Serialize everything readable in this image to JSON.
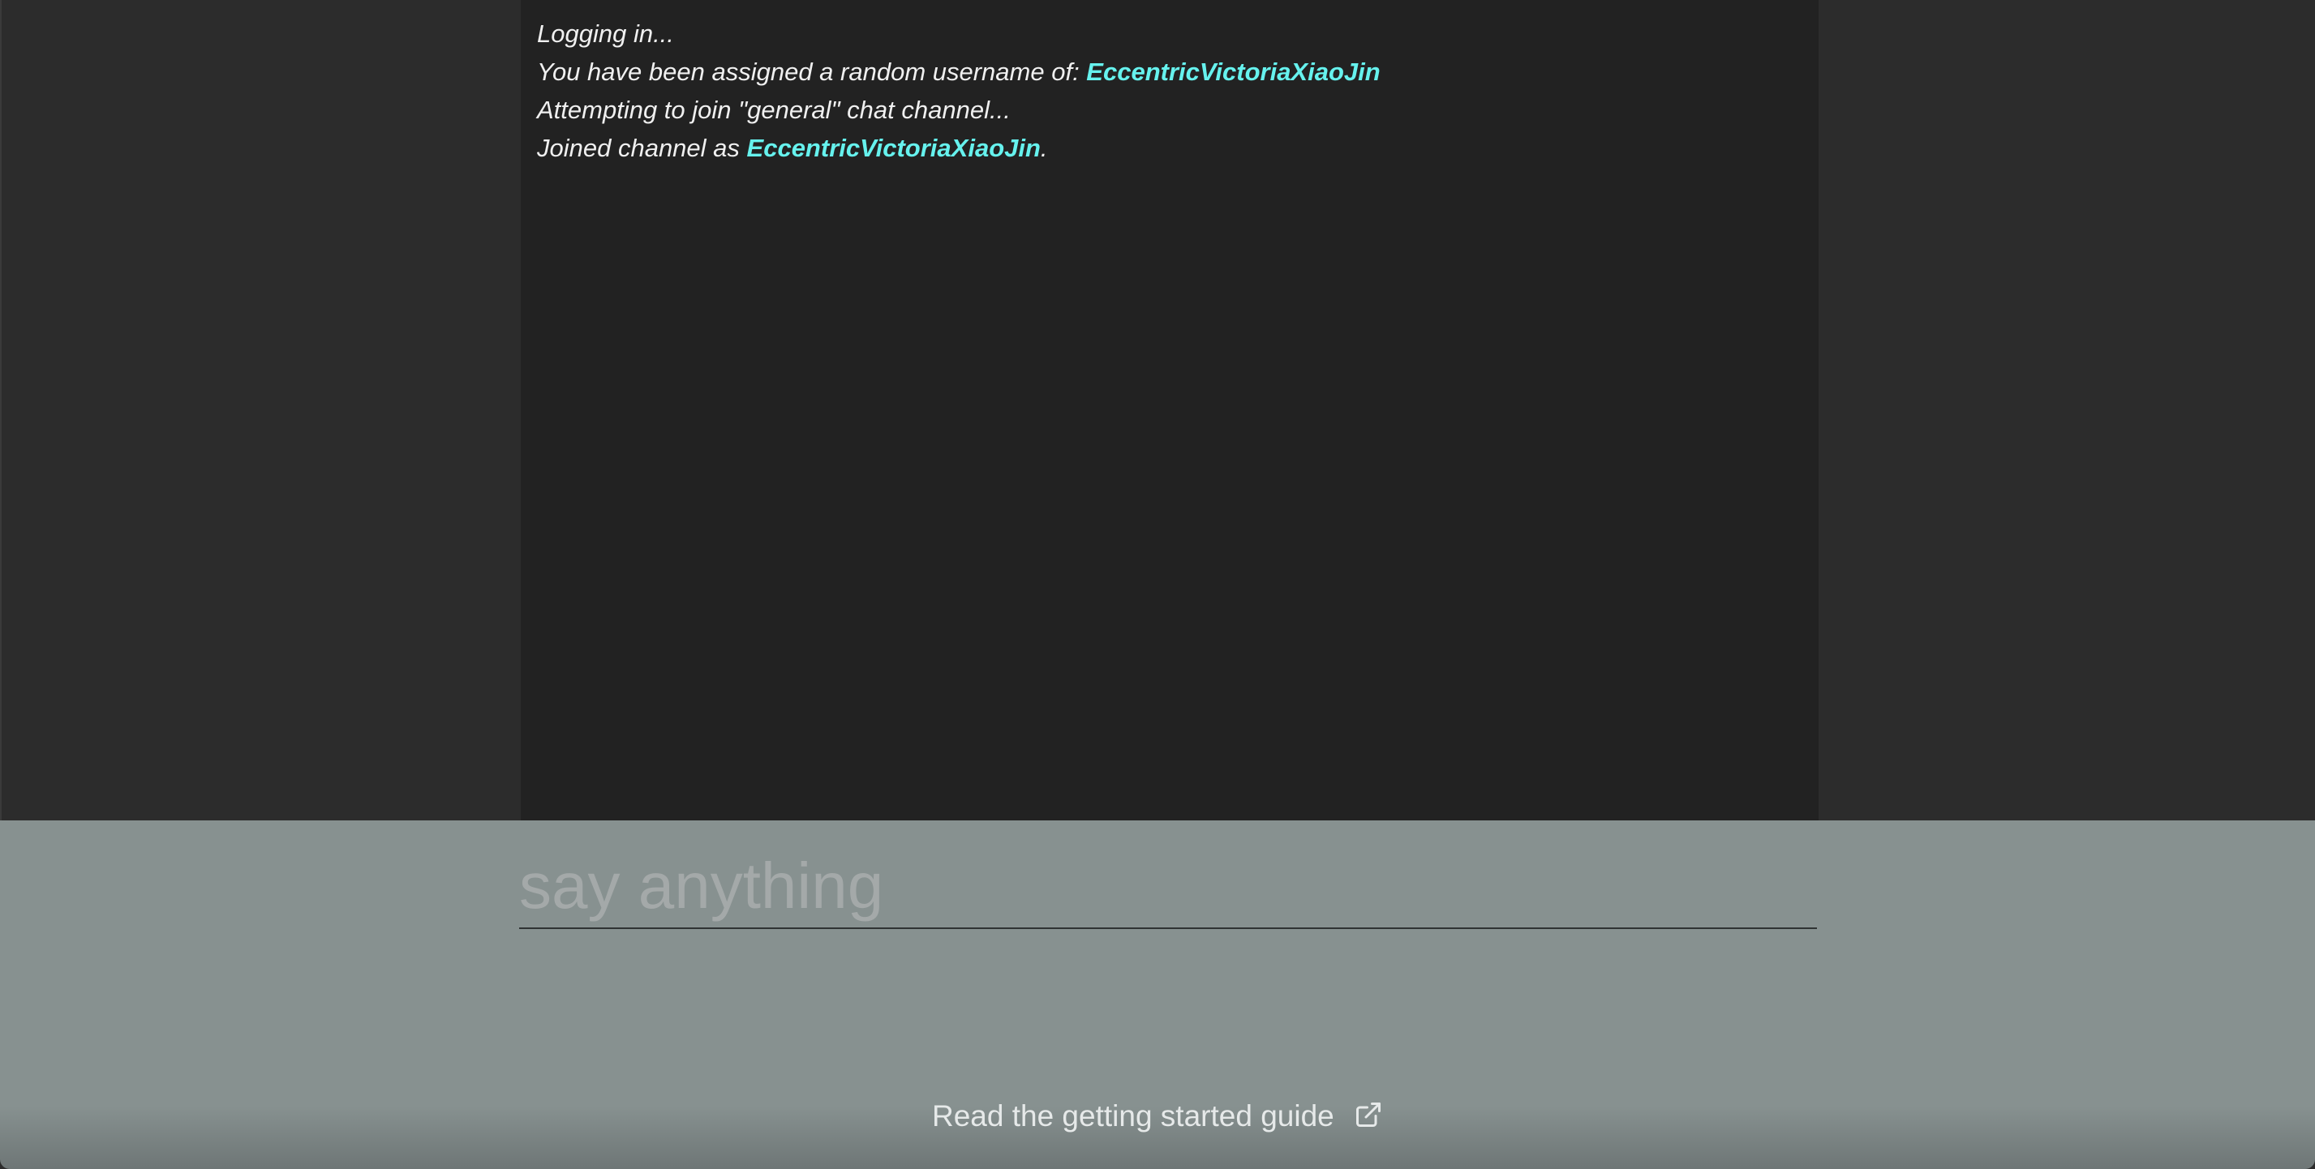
{
  "chat": {
    "lines": [
      {
        "text": "Logging in..."
      },
      {
        "prefix": "You have been assigned a random username of: ",
        "username": "EccentricVictoriaXiaoJin"
      },
      {
        "text": "Attempting to join \"general\" chat channel..."
      },
      {
        "prefix": "Joined channel as ",
        "username": "EccentricVictoriaXiaoJin",
        "suffix": "."
      }
    ]
  },
  "input": {
    "placeholder": "say anything",
    "value": ""
  },
  "footer": {
    "guide_link": "Read the getting started guide",
    "guide_icon": "external-link-icon"
  },
  "colors": {
    "username": "#66f2ee",
    "log_bg": "#222222",
    "page_bg": "#2c2c2c",
    "input_area_bg": "#879190"
  }
}
